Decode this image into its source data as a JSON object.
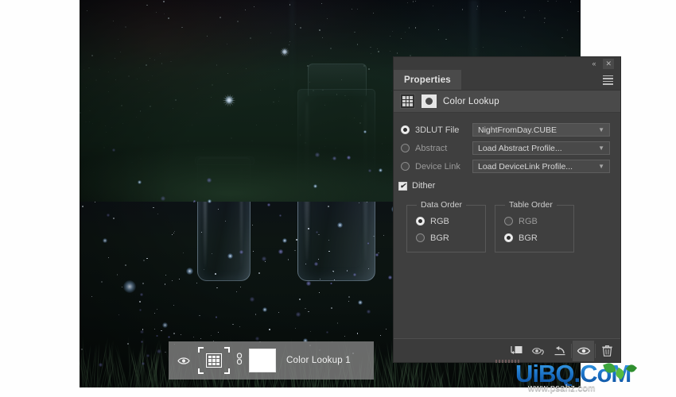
{
  "app": {
    "panel_title": "Properties",
    "adjustment_title": "Color Lookup"
  },
  "window_controls": {
    "collapse_label": "«",
    "close_label": "✕",
    "menu_name": "panel-menu"
  },
  "color_lookup": {
    "options": [
      {
        "id": "3dlut",
        "label": "3DLUT File",
        "selected": true,
        "value": "NightFromDay.CUBE"
      },
      {
        "id": "abstract",
        "label": "Abstract",
        "selected": false,
        "value": "Load Abstract Profile..."
      },
      {
        "id": "devicelink",
        "label": "Device Link",
        "selected": false,
        "value": "Load DeviceLink Profile..."
      }
    ],
    "dither": {
      "label": "Dither",
      "checked": true,
      "mark": "✔"
    },
    "data_order": {
      "legend": "Data Order",
      "items": [
        {
          "label": "RGB",
          "selected": true
        },
        {
          "label": "BGR",
          "selected": false
        }
      ]
    },
    "table_order": {
      "legend": "Table Order",
      "items": [
        {
          "label": "RGB",
          "selected": false
        },
        {
          "label": "BGR",
          "selected": true
        }
      ]
    }
  },
  "panel_toolbar": {
    "buttons": [
      {
        "name": "clip-to-layer-icon",
        "title": "Clip to layer"
      },
      {
        "name": "view-previous-state-icon",
        "title": "View previous state"
      },
      {
        "name": "reset-icon",
        "title": "Reset to adjustment defaults"
      },
      {
        "name": "toggle-visibility-icon",
        "title": "Toggle layer visibility",
        "active": true
      },
      {
        "name": "delete-layer-icon",
        "title": "Delete this adjustment layer"
      }
    ]
  },
  "layer_bar": {
    "visibility_icon": "eye-icon",
    "layer_name": "Color Lookup 1"
  },
  "watermark": {
    "brand": "UiBQ.CoM",
    "url": "www.psahz.com"
  },
  "colors": {
    "panel_bg": "#3f3f3f",
    "panel_header": "#4a4a4a",
    "field_bg": "#494949",
    "text": "#d4d4d4",
    "accent_white": "#ffffff"
  }
}
